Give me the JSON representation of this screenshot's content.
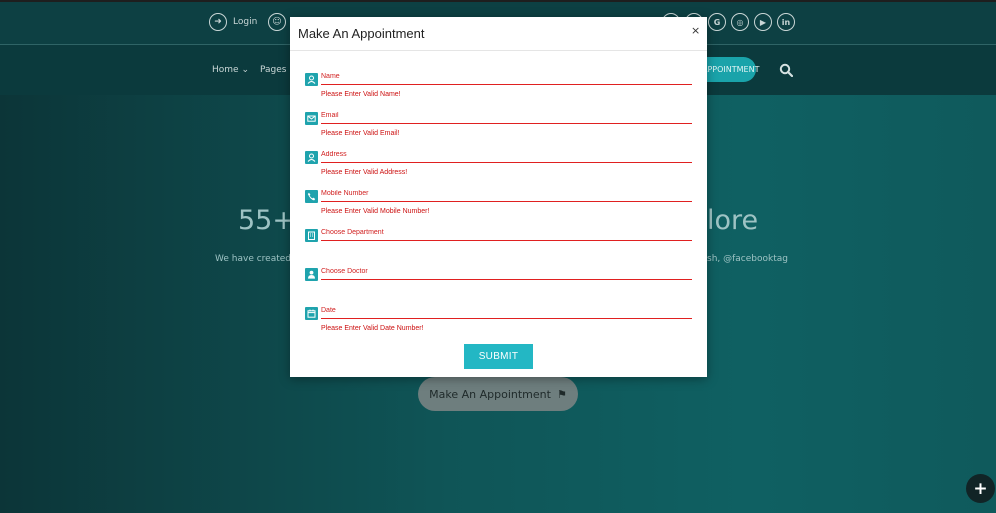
{
  "background": {
    "login_label": "Login",
    "nav": {
      "home": "Home",
      "pages": "Pages"
    },
    "appointment_pill": "APPOINTMENT",
    "hero_left": "55+",
    "hero_right": "lore",
    "subtitle_left": "We have created",
    "subtitle_right": "sh, @facebooktag",
    "hero_button": "Make An Appointment",
    "social_icons": [
      "google-icon",
      "instagram-icon",
      "youtube-icon",
      "linkedin-icon"
    ],
    "social_letters": {
      "google": "G",
      "instagram": "◎",
      "youtube": "▶",
      "linkedin": "in"
    },
    "fab_label": "+"
  },
  "modal": {
    "title": "Make An Appointment",
    "close": "×",
    "fields": [
      {
        "icon": "user-icon",
        "placeholder": "Name",
        "error": "Please Enter Valid Name!"
      },
      {
        "icon": "envelope-icon",
        "placeholder": "Email",
        "error": "Please Enter Valid Email!"
      },
      {
        "icon": "user-icon",
        "placeholder": "Address",
        "error": "Please Enter Valid Address!"
      },
      {
        "icon": "phone-icon",
        "placeholder": "Mobile Number",
        "error": "Please Enter Valid Mobile Number!"
      },
      {
        "icon": "building-icon",
        "placeholder": "Choose Department",
        "error": ""
      },
      {
        "icon": "doctor-icon",
        "placeholder": "Choose Doctor",
        "error": ""
      },
      {
        "icon": "calendar-icon",
        "placeholder": "Date",
        "error": "Please Enter Valid Date Number!"
      }
    ],
    "submit": "SUBMIT"
  },
  "colors": {
    "accent": "#23b7c4",
    "error": "#e02020",
    "background": "#0f5557"
  }
}
